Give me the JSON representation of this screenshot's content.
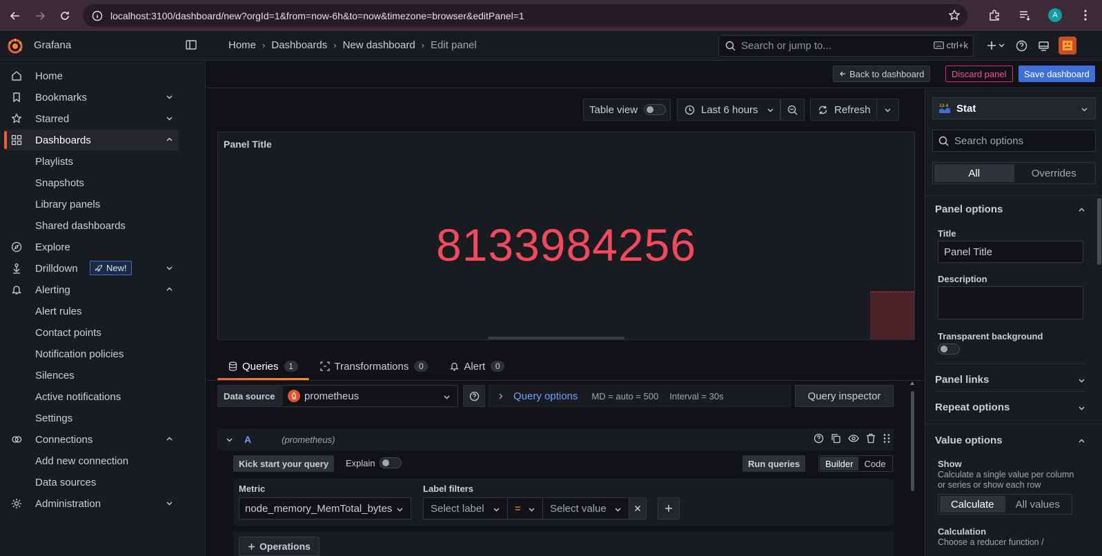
{
  "browser": {
    "url": "localhost:3100/dashboard/new?orgId=1&from=now-6h&to=now&timezone=browser&editPanel=1",
    "profile_initial": "A"
  },
  "topbar": {
    "brand": "Grafana",
    "breadcrumb": [
      "Home",
      "Dashboards",
      "New dashboard",
      "Edit panel"
    ],
    "search_placeholder": "Search or jump to...",
    "search_shortcut": "ctrl+k"
  },
  "sidebar": {
    "items": [
      {
        "label": "Home",
        "icon": "home-icon"
      },
      {
        "label": "Bookmarks",
        "icon": "bookmark-icon",
        "chevron": "down"
      },
      {
        "label": "Starred",
        "icon": "star-icon",
        "chevron": "down"
      },
      {
        "label": "Dashboards",
        "icon": "apps-icon",
        "chevron": "up",
        "active": true
      },
      {
        "label": "Playlists",
        "sub": true
      },
      {
        "label": "Snapshots",
        "sub": true
      },
      {
        "label": "Library panels",
        "sub": true
      },
      {
        "label": "Shared dashboards",
        "sub": true
      },
      {
        "label": "Explore",
        "icon": "compass-icon"
      },
      {
        "label": "Drilldown",
        "icon": "drilldown-icon",
        "chevron": "down",
        "badge": "New!"
      },
      {
        "label": "Alerting",
        "icon": "bell-icon",
        "chevron": "up"
      },
      {
        "label": "Alert rules",
        "sub": true
      },
      {
        "label": "Contact points",
        "sub": true
      },
      {
        "label": "Notification policies",
        "sub": true
      },
      {
        "label": "Silences",
        "sub": true
      },
      {
        "label": "Active notifications",
        "sub": true
      },
      {
        "label": "Settings",
        "sub": true
      },
      {
        "label": "Connections",
        "icon": "connections-icon",
        "chevron": "up"
      },
      {
        "label": "Add new connection",
        "sub": true
      },
      {
        "label": "Data sources",
        "sub": true
      },
      {
        "label": "Administration",
        "icon": "cog-icon",
        "chevron": "down"
      }
    ]
  },
  "edit_toolbar": {
    "back_label": "Back to dashboard",
    "discard_label": "Discard panel",
    "save_label": "Save dashboard"
  },
  "panel_controls": {
    "table_view": "Table view",
    "time_range": "Last 6 hours",
    "refresh": "Refresh"
  },
  "panel": {
    "title": "Panel Title",
    "value": "8133984256",
    "value_color": "#f2495c"
  },
  "query_tabs": [
    {
      "label": "Queries",
      "count": "1",
      "active": true
    },
    {
      "label": "Transformations",
      "count": "0"
    },
    {
      "label": "Alert",
      "count": "0"
    }
  ],
  "query_row": {
    "datasource_label": "Data source",
    "datasource": "prometheus",
    "query_options": "Query options",
    "md": "MD = auto = 500",
    "interval": "Interval = 30s",
    "inspector": "Query inspector"
  },
  "query": {
    "ref_id": "A",
    "ds_name": "(prometheus)",
    "kick_start": "Kick start your query",
    "explain": "Explain",
    "run": "Run queries",
    "modes": [
      "Builder",
      "Code"
    ],
    "metric_label": "Metric",
    "metric": "node_memory_MemTotal_bytes",
    "label_filters_label": "Label filters",
    "select_label": "Select label",
    "operator": "=",
    "select_value": "Select value",
    "operations": "Operations"
  },
  "options": {
    "viz": "Stat",
    "search_placeholder": "Search options",
    "tabs": [
      "All",
      "Overrides"
    ],
    "panel_options": "Panel options",
    "title_label": "Title",
    "title_value": "Panel Title",
    "description_label": "Description",
    "transparent_label": "Transparent background",
    "panel_links": "Panel links",
    "repeat_options": "Repeat options",
    "value_options": "Value options",
    "show_label": "Show",
    "show_desc": "Calculate a single value per column or series or show each row",
    "show_modes": [
      "Calculate",
      "All values"
    ],
    "calculation_label": "Calculation",
    "calculation_desc": "Choose a reducer function /"
  }
}
